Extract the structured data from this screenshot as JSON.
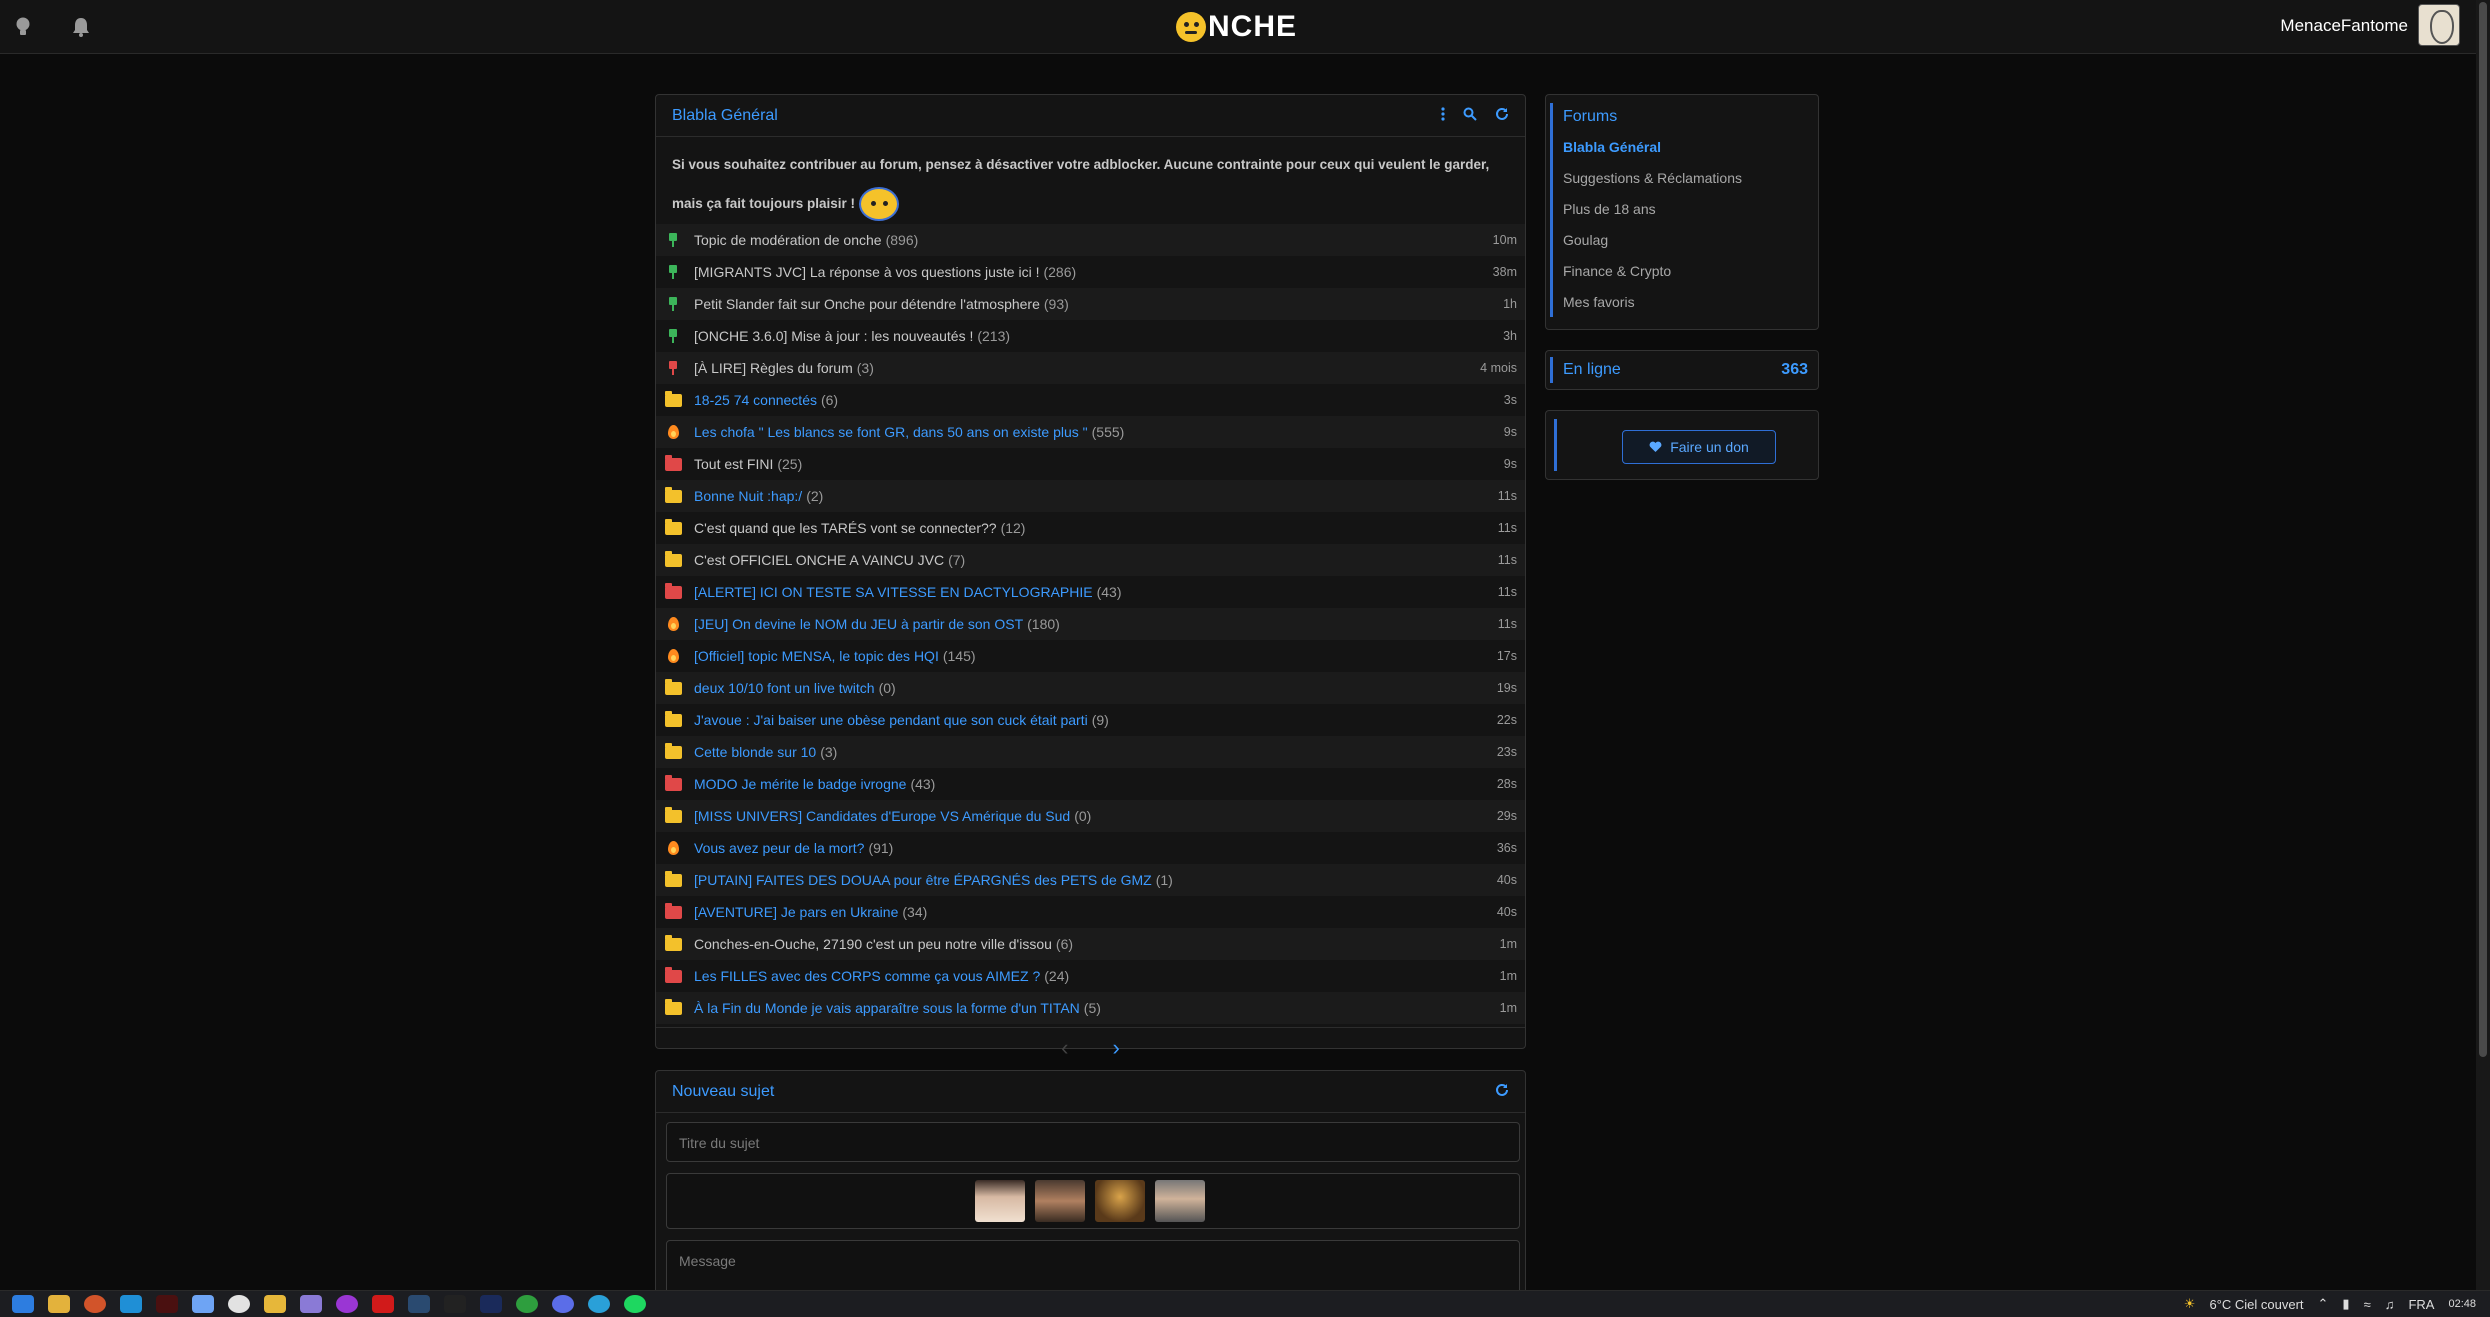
{
  "header": {
    "logo_text": "NCHE",
    "username": "MenaceFantome",
    "icons": [
      "lightbulb-icon",
      "bell-icon"
    ]
  },
  "forum": {
    "title": "Blabla Général",
    "notice": "Si vous souhaitez contribuer au forum, pensez à désactiver votre adblocker. Aucune contrainte pour ceux qui veulent le garder, mais ça fait toujours plaisir !",
    "topics": [
      {
        "icon": "pin-green",
        "title": "Topic de modération de onche",
        "count": "(896)",
        "time": "10m",
        "link": false
      },
      {
        "icon": "pin-green",
        "title": "[MIGRANTS JVC] La réponse à vos questions juste ici !",
        "count": "(286)",
        "time": "38m",
        "link": false
      },
      {
        "icon": "pin-green",
        "title": "Petit Slander fait sur Onche pour détendre l'atmosphere",
        "count": "(93)",
        "time": "1h",
        "link": false
      },
      {
        "icon": "pin-green",
        "title": "[ONCHE 3.6.0] Mise à jour : les nouveautés !",
        "count": "(213)",
        "time": "3h",
        "link": false
      },
      {
        "icon": "pin-red",
        "title": "[À LIRE] Règles du forum",
        "count": "(3)",
        "time": "4 mois",
        "link": false
      },
      {
        "icon": "folder-yellow",
        "title": "18-25 74 connectés",
        "count": "(6)",
        "time": "3s",
        "link": true
      },
      {
        "icon": "flame",
        "title": "Les chofa \" Les blancs se font GR, dans 50 ans on existe plus \"",
        "count": "(555)",
        "time": "9s",
        "link": true
      },
      {
        "icon": "folder-red",
        "title": "Tout est FINI",
        "count": "(25)",
        "time": "9s",
        "link": false
      },
      {
        "icon": "folder-yellow",
        "title": "Bonne Nuit :hap:/",
        "count": "(2)",
        "time": "11s",
        "link": true
      },
      {
        "icon": "folder-yellow",
        "title": "C'est quand que les TARÉS vont se connecter??",
        "count": "(12)",
        "time": "11s",
        "link": false
      },
      {
        "icon": "folder-yellow",
        "title": "C'est OFFICIEL ONCHE A VAINCU JVC",
        "count": "(7)",
        "time": "11s",
        "link": false
      },
      {
        "icon": "folder-red",
        "title": "[ALERTE] ICI ON TESTE SA VITESSE EN DACTYLOGRAPHIE",
        "count": "(43)",
        "time": "11s",
        "link": true
      },
      {
        "icon": "flame",
        "title": "[JEU] On devine le NOM du JEU à partir de son OST",
        "count": "(180)",
        "time": "11s",
        "link": true
      },
      {
        "icon": "flame",
        "title": "[Officiel] topic MENSA, le topic des HQI",
        "count": "(145)",
        "time": "17s",
        "link": true
      },
      {
        "icon": "folder-yellow",
        "title": "deux 10/10 font un live twitch",
        "count": "(0)",
        "time": "19s",
        "link": true
      },
      {
        "icon": "folder-yellow",
        "title": "J'avoue : J'ai baiser une obèse pendant que son cuck était parti",
        "count": "(9)",
        "time": "22s",
        "link": true
      },
      {
        "icon": "folder-yellow",
        "title": "Cette blonde sur 10",
        "count": "(3)",
        "time": "23s",
        "link": true
      },
      {
        "icon": "folder-red",
        "title": "MODO Je mérite le badge ivrogne",
        "count": "(43)",
        "time": "28s",
        "link": true
      },
      {
        "icon": "folder-yellow",
        "title": "[MISS UNIVERS] Candidates d'Europe VS Amérique du Sud",
        "count": "(0)",
        "time": "29s",
        "link": true
      },
      {
        "icon": "flame",
        "title": "Vous avez peur de la mort?",
        "count": "(91)",
        "time": "36s",
        "link": true
      },
      {
        "icon": "folder-yellow",
        "title": "[PUTAIN] FAITES DES DOUAA pour être ÉPARGNÉS des PETS de GMZ",
        "count": "(1)",
        "time": "40s",
        "link": true
      },
      {
        "icon": "folder-red",
        "title": "[AVENTURE] Je pars en Ukraine",
        "count": "(34)",
        "time": "40s",
        "link": true
      },
      {
        "icon": "folder-yellow",
        "title": "Conches-en-Ouche, 27190 c'est un peu notre ville d'issou",
        "count": "(6)",
        "time": "1m",
        "link": false
      },
      {
        "icon": "folder-red",
        "title": "Les FILLES avec des CORPS comme ça vous AIMEZ ?",
        "count": "(24)",
        "time": "1m",
        "link": true
      },
      {
        "icon": "folder-yellow",
        "title": "À la Fin du Monde je vais apparaître sous la forme d'un TITAN",
        "count": "(5)",
        "time": "1m",
        "link": true
      }
    ]
  },
  "sidebar": {
    "forums_title": "Forums",
    "items": [
      {
        "label": "Blabla Général",
        "active": true
      },
      {
        "label": "Suggestions & Réclamations",
        "active": false
      },
      {
        "label": "Plus de 18 ans",
        "active": false
      },
      {
        "label": "Goulag",
        "active": false
      },
      {
        "label": "Finance & Crypto",
        "active": false
      },
      {
        "label": "Mes favoris",
        "active": false
      }
    ],
    "online_label": "En ligne",
    "online_count": "363",
    "donate_label": "Faire un don"
  },
  "new_topic": {
    "title": "Nouveau sujet",
    "subject_placeholder": "Titre du sujet",
    "message_placeholder": "Message"
  },
  "taskbar": {
    "weather": "6°C  Ciel couvert",
    "language": "FRA",
    "clock": "02:48"
  },
  "colors": {
    "accent": "#3d9bff",
    "background": "#0b0b0b",
    "panel": "#141414"
  }
}
